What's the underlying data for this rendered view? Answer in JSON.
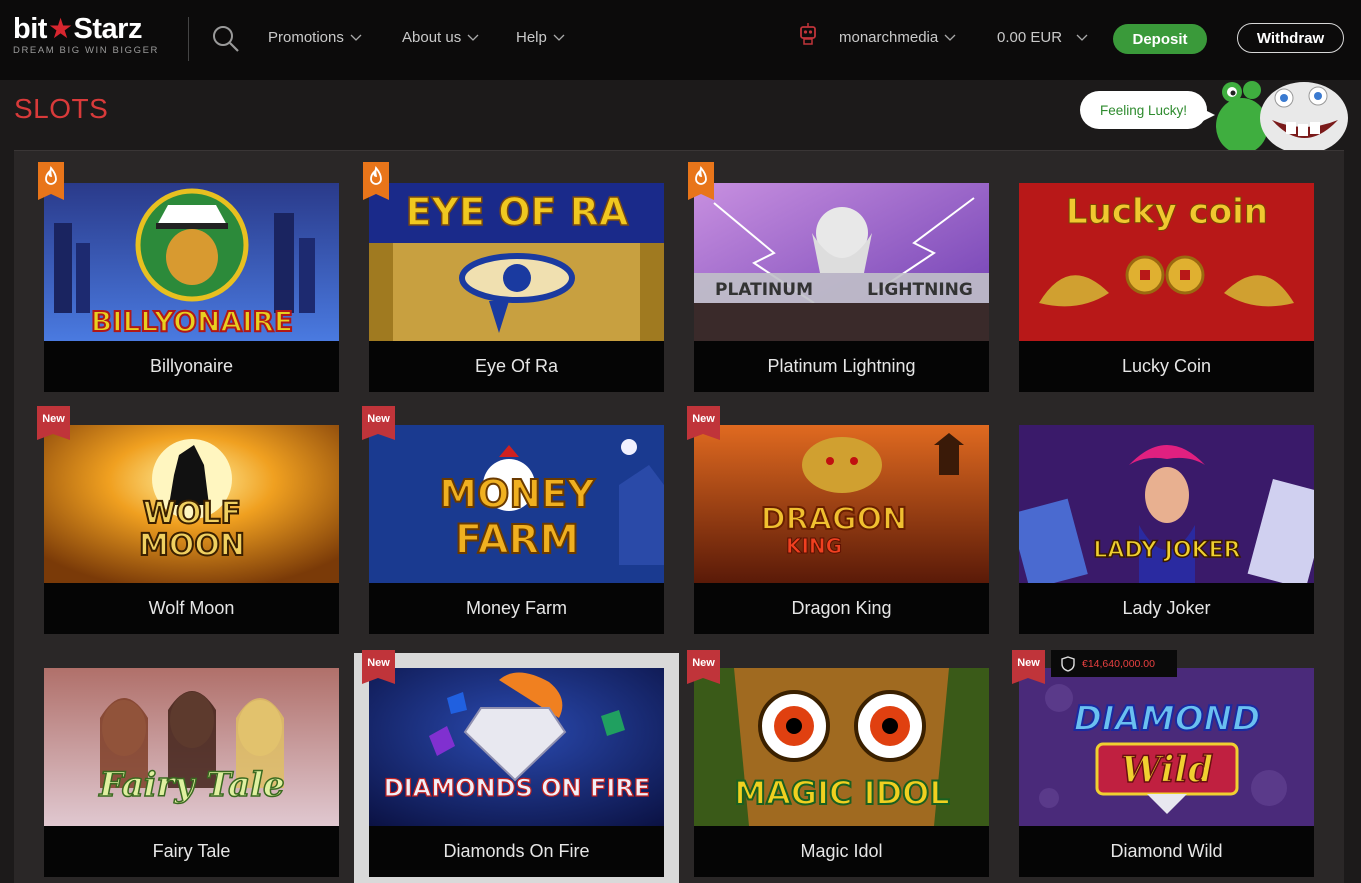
{
  "header": {
    "logo_text_a": "bit",
    "logo_text_b": "Starz",
    "logo_tagline": "DREAM BIG  WIN BIGGER",
    "nav": [
      {
        "label": "Promotions"
      },
      {
        "label": "About us"
      },
      {
        "label": "Help"
      }
    ],
    "username": "monarchmedia",
    "balance": "0.00 EUR",
    "deposit_label": "Deposit",
    "withdraw_label": "Withdraw",
    "icons": [
      "search-icon",
      "robot-icon",
      "chevron-down-icon"
    ]
  },
  "page": {
    "title": "SLOTS",
    "lucky_bubble": "Feeling Lucky!"
  },
  "colors": {
    "accent_red": "#d83a3a",
    "deposit_green": "#3a9a3a",
    "hot_badge": "#e8751a",
    "new_badge": "#c0343a",
    "background": "#1c1a1a"
  },
  "games": [
    {
      "name": "Billyonaire",
      "badge": "hot",
      "art_text": "BILLYONAIRE"
    },
    {
      "name": "Eye Of Ra",
      "badge": "hot",
      "art_text": "EYE OF RA"
    },
    {
      "name": "Platinum Lightning",
      "badge": "hot",
      "art_text_a": "PLATINUM",
      "art_text_b": "LIGHTNING"
    },
    {
      "name": "Lucky Coin",
      "badge": "",
      "art_text": "Lucky coin"
    },
    {
      "name": "Wolf Moon",
      "badge": "New",
      "art_text_a": "WOLF",
      "art_text_b": "MOON"
    },
    {
      "name": "Money Farm",
      "badge": "New",
      "art_text_a": "MONEY",
      "art_text_b": "FARM"
    },
    {
      "name": "Dragon King",
      "badge": "New",
      "art_text_a": "DRAGON",
      "art_text_b": "KING"
    },
    {
      "name": "Lady Joker",
      "badge": "",
      "art_text": "LADY JOKER"
    },
    {
      "name": "Fairy Tale",
      "badge": "",
      "art_text": "Fairy Tale"
    },
    {
      "name": "Diamonds On Fire",
      "badge": "New",
      "art_text": "DIAMONDS ON FIRE",
      "highlighted": true
    },
    {
      "name": "Magic Idol",
      "badge": "New",
      "art_text": "MAGIC IDOL"
    },
    {
      "name": "Diamond Wild",
      "badge": "New",
      "art_text_a": "DIAMOND",
      "art_text_b": "Wild",
      "jackpot": "€14,640,000.00"
    }
  ]
}
